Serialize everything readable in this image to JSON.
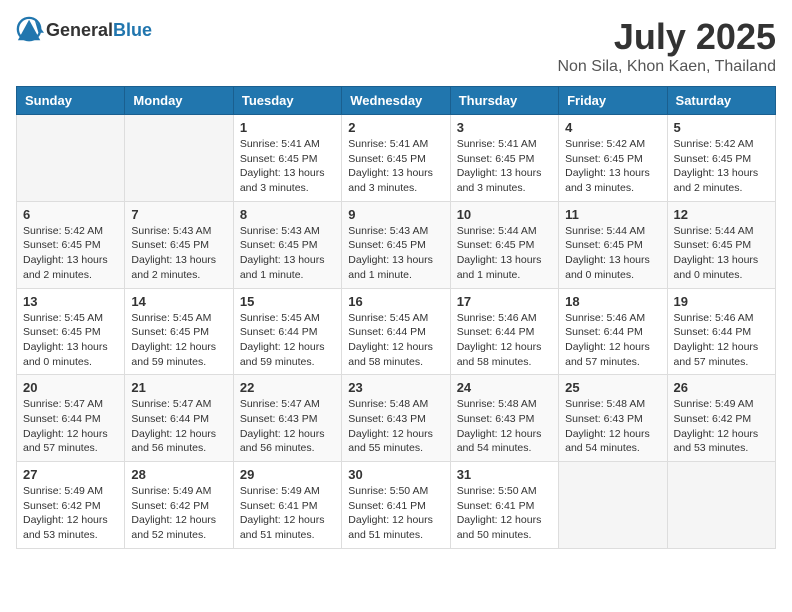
{
  "header": {
    "logo_general": "General",
    "logo_blue": "Blue",
    "title": "July 2025",
    "subtitle": "Non Sila, Khon Kaen, Thailand"
  },
  "weekdays": [
    "Sunday",
    "Monday",
    "Tuesday",
    "Wednesday",
    "Thursday",
    "Friday",
    "Saturday"
  ],
  "weeks": [
    [
      {
        "day": "",
        "info": ""
      },
      {
        "day": "",
        "info": ""
      },
      {
        "day": "1",
        "info": "Sunrise: 5:41 AM\nSunset: 6:45 PM\nDaylight: 13 hours and 3 minutes."
      },
      {
        "day": "2",
        "info": "Sunrise: 5:41 AM\nSunset: 6:45 PM\nDaylight: 13 hours and 3 minutes."
      },
      {
        "day": "3",
        "info": "Sunrise: 5:41 AM\nSunset: 6:45 PM\nDaylight: 13 hours and 3 minutes."
      },
      {
        "day": "4",
        "info": "Sunrise: 5:42 AM\nSunset: 6:45 PM\nDaylight: 13 hours and 3 minutes."
      },
      {
        "day": "5",
        "info": "Sunrise: 5:42 AM\nSunset: 6:45 PM\nDaylight: 13 hours and 2 minutes."
      }
    ],
    [
      {
        "day": "6",
        "info": "Sunrise: 5:42 AM\nSunset: 6:45 PM\nDaylight: 13 hours and 2 minutes."
      },
      {
        "day": "7",
        "info": "Sunrise: 5:43 AM\nSunset: 6:45 PM\nDaylight: 13 hours and 2 minutes."
      },
      {
        "day": "8",
        "info": "Sunrise: 5:43 AM\nSunset: 6:45 PM\nDaylight: 13 hours and 1 minute."
      },
      {
        "day": "9",
        "info": "Sunrise: 5:43 AM\nSunset: 6:45 PM\nDaylight: 13 hours and 1 minute."
      },
      {
        "day": "10",
        "info": "Sunrise: 5:44 AM\nSunset: 6:45 PM\nDaylight: 13 hours and 1 minute."
      },
      {
        "day": "11",
        "info": "Sunrise: 5:44 AM\nSunset: 6:45 PM\nDaylight: 13 hours and 0 minutes."
      },
      {
        "day": "12",
        "info": "Sunrise: 5:44 AM\nSunset: 6:45 PM\nDaylight: 13 hours and 0 minutes."
      }
    ],
    [
      {
        "day": "13",
        "info": "Sunrise: 5:45 AM\nSunset: 6:45 PM\nDaylight: 13 hours and 0 minutes."
      },
      {
        "day": "14",
        "info": "Sunrise: 5:45 AM\nSunset: 6:45 PM\nDaylight: 12 hours and 59 minutes."
      },
      {
        "day": "15",
        "info": "Sunrise: 5:45 AM\nSunset: 6:44 PM\nDaylight: 12 hours and 59 minutes."
      },
      {
        "day": "16",
        "info": "Sunrise: 5:45 AM\nSunset: 6:44 PM\nDaylight: 12 hours and 58 minutes."
      },
      {
        "day": "17",
        "info": "Sunrise: 5:46 AM\nSunset: 6:44 PM\nDaylight: 12 hours and 58 minutes."
      },
      {
        "day": "18",
        "info": "Sunrise: 5:46 AM\nSunset: 6:44 PM\nDaylight: 12 hours and 57 minutes."
      },
      {
        "day": "19",
        "info": "Sunrise: 5:46 AM\nSunset: 6:44 PM\nDaylight: 12 hours and 57 minutes."
      }
    ],
    [
      {
        "day": "20",
        "info": "Sunrise: 5:47 AM\nSunset: 6:44 PM\nDaylight: 12 hours and 57 minutes."
      },
      {
        "day": "21",
        "info": "Sunrise: 5:47 AM\nSunset: 6:44 PM\nDaylight: 12 hours and 56 minutes."
      },
      {
        "day": "22",
        "info": "Sunrise: 5:47 AM\nSunset: 6:43 PM\nDaylight: 12 hours and 56 minutes."
      },
      {
        "day": "23",
        "info": "Sunrise: 5:48 AM\nSunset: 6:43 PM\nDaylight: 12 hours and 55 minutes."
      },
      {
        "day": "24",
        "info": "Sunrise: 5:48 AM\nSunset: 6:43 PM\nDaylight: 12 hours and 54 minutes."
      },
      {
        "day": "25",
        "info": "Sunrise: 5:48 AM\nSunset: 6:43 PM\nDaylight: 12 hours and 54 minutes."
      },
      {
        "day": "26",
        "info": "Sunrise: 5:49 AM\nSunset: 6:42 PM\nDaylight: 12 hours and 53 minutes."
      }
    ],
    [
      {
        "day": "27",
        "info": "Sunrise: 5:49 AM\nSunset: 6:42 PM\nDaylight: 12 hours and 53 minutes."
      },
      {
        "day": "28",
        "info": "Sunrise: 5:49 AM\nSunset: 6:42 PM\nDaylight: 12 hours and 52 minutes."
      },
      {
        "day": "29",
        "info": "Sunrise: 5:49 AM\nSunset: 6:41 PM\nDaylight: 12 hours and 51 minutes."
      },
      {
        "day": "30",
        "info": "Sunrise: 5:50 AM\nSunset: 6:41 PM\nDaylight: 12 hours and 51 minutes."
      },
      {
        "day": "31",
        "info": "Sunrise: 5:50 AM\nSunset: 6:41 PM\nDaylight: 12 hours and 50 minutes."
      },
      {
        "day": "",
        "info": ""
      },
      {
        "day": "",
        "info": ""
      }
    ]
  ]
}
